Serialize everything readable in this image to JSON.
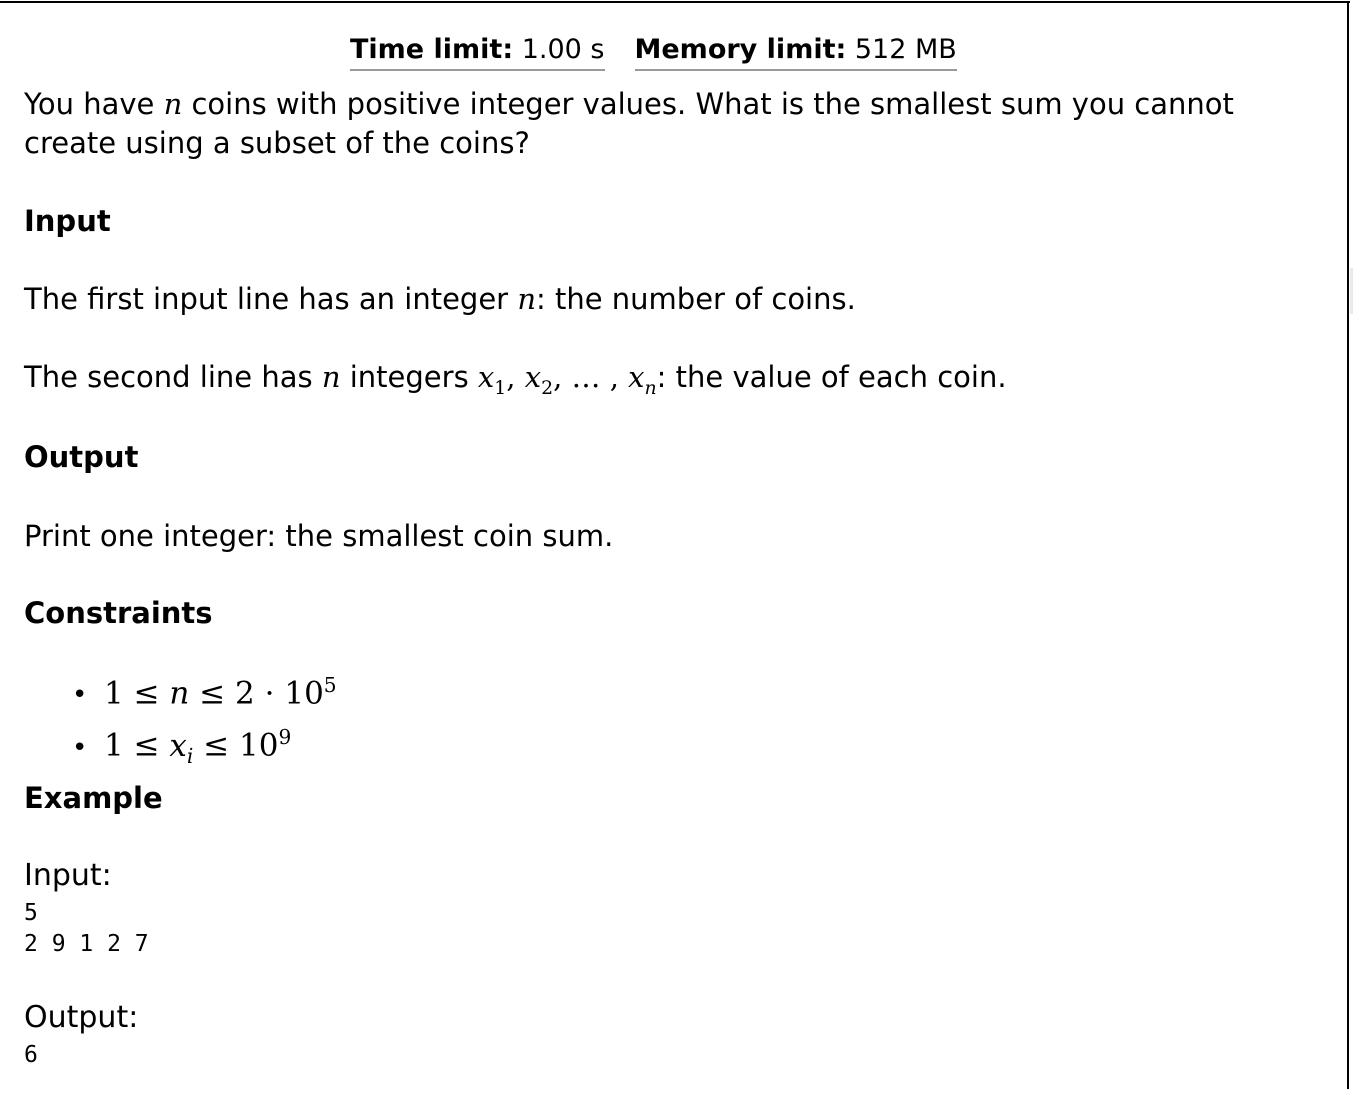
{
  "limits": {
    "time_label": "Time limit:",
    "time_value": "1.00 s",
    "memory_label": "Memory limit:",
    "memory_value": "512 MB"
  },
  "statement": {
    "p1_a": "You have",
    "p1_b": "coins with positive integer values. What is the smallest sum you cannot create using a subset of the coins?"
  },
  "input_section": {
    "heading": "Input",
    "line1_a": "The first input line has an integer",
    "line1_b": ": the number of coins.",
    "line2_a": "The second line has",
    "line2_b": "integers",
    "line2_c": ": the value of each coin."
  },
  "output_section": {
    "heading": "Output",
    "text": "Print one integer: the smallest coin sum."
  },
  "constraints": {
    "heading": "Constraints"
  },
  "example": {
    "heading": "Example",
    "input_label": "Input:",
    "input_lines": "5\n2 9 1 2 7",
    "output_label": "Output:",
    "output_lines": "6"
  }
}
